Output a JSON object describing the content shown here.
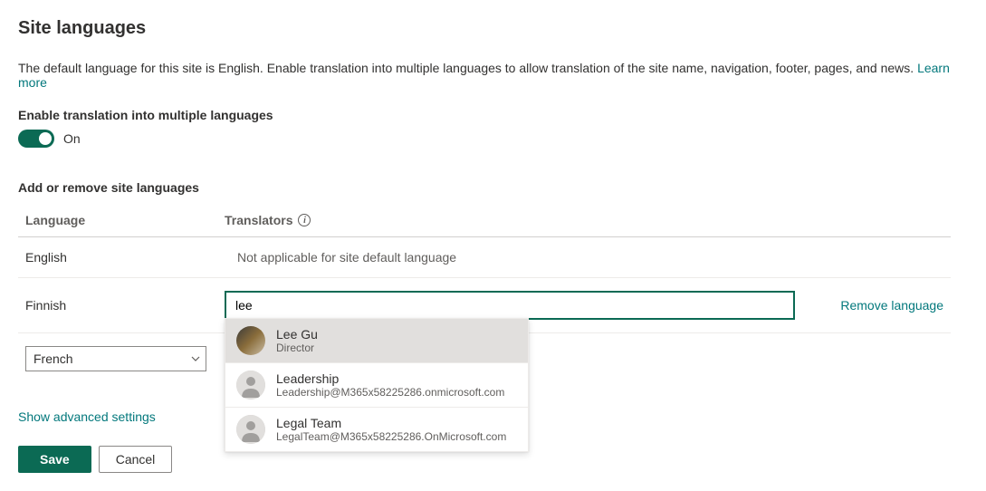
{
  "page": {
    "title": "Site languages",
    "intro": "The default language for this site is English. Enable translation into multiple languages to allow translation of the site name, navigation, footer, pages, and news. ",
    "learn_more": "Learn more"
  },
  "toggle": {
    "label": "Enable translation into multiple languages",
    "state": "On"
  },
  "languages_section": {
    "label": "Add or remove site languages",
    "col_language": "Language",
    "col_translators": "Translators",
    "rows": [
      {
        "name": "English",
        "translator_na": "Not applicable for site default language"
      },
      {
        "name": "Finnish",
        "translator_value": "lee",
        "remove_label": "Remove language"
      }
    ],
    "add_select_value": "French"
  },
  "people_picker": {
    "items": [
      {
        "name": "Lee Gu",
        "sub": "Director",
        "highlighted": true,
        "photo": true
      },
      {
        "name": "Leadership",
        "sub": "Leadership@M365x58225286.onmicrosoft.com",
        "highlighted": false,
        "photo": false
      },
      {
        "name": "Legal Team",
        "sub": "LegalTeam@M365x58225286.OnMicrosoft.com",
        "highlighted": false,
        "photo": false
      }
    ]
  },
  "advanced_link": "Show advanced settings",
  "buttons": {
    "save": "Save",
    "cancel": "Cancel"
  }
}
